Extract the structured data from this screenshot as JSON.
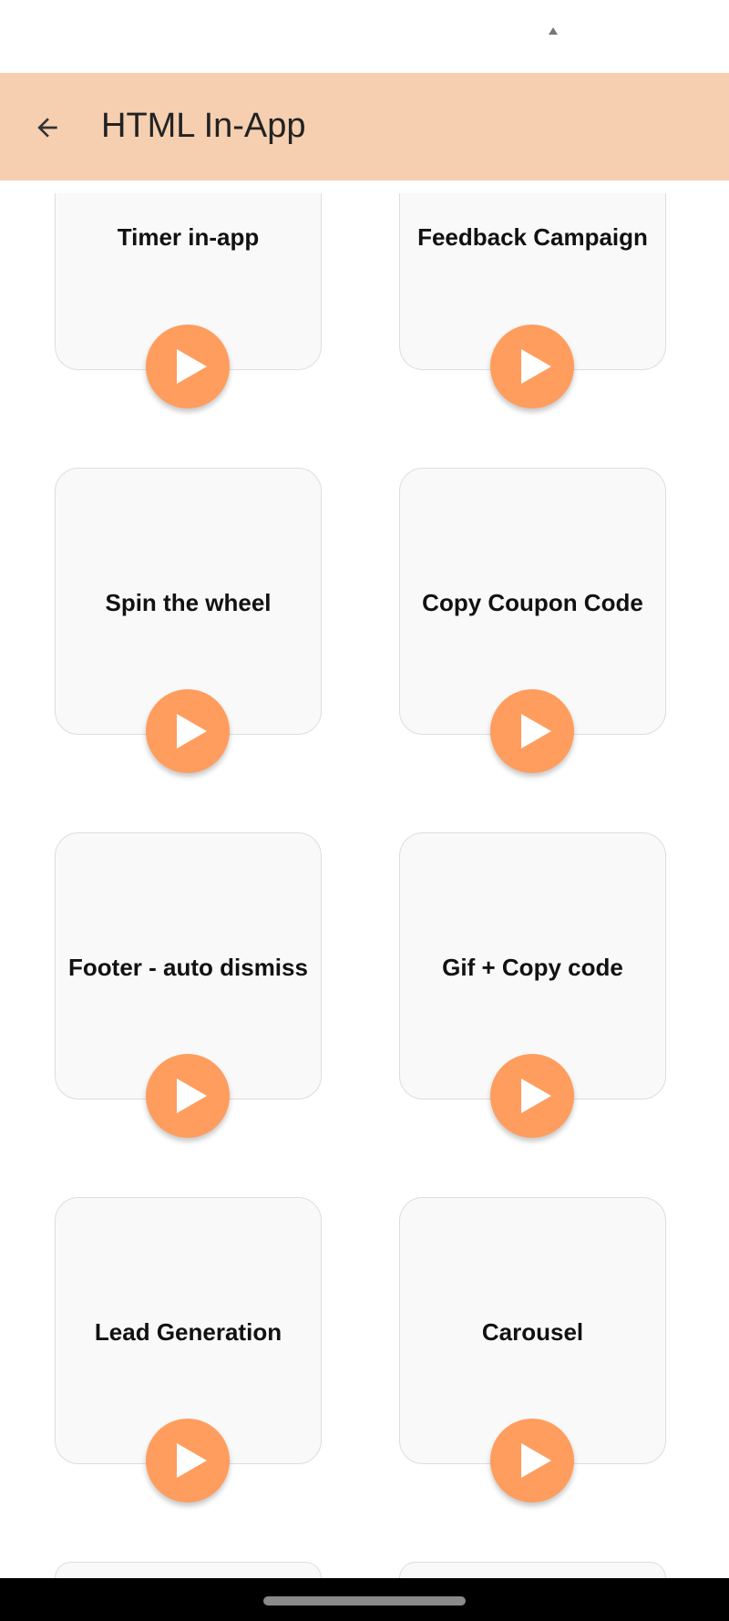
{
  "header": {
    "title": "HTML In-App",
    "back_icon": "arrow-left-icon",
    "background": "#f5cfb0"
  },
  "accent": "#fe9d5e",
  "cards": [
    {
      "label": "Timer in-app"
    },
    {
      "label": "Feedback Campaign"
    },
    {
      "label": "Spin the wheel"
    },
    {
      "label": "Copy Coupon Code"
    },
    {
      "label": "Footer - auto dismiss"
    },
    {
      "label": "Gif + Copy code"
    },
    {
      "label": "Lead Generation"
    },
    {
      "label": "Carousel"
    },
    {
      "label": ""
    },
    {
      "label": ""
    }
  ]
}
